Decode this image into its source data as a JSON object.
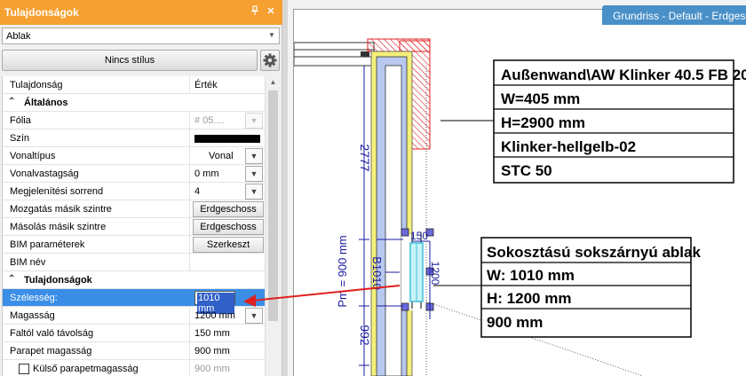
{
  "panel": {
    "title": "Tulajdonságok",
    "pin_icon": "pin-icon",
    "close_icon": "close-icon",
    "type_selector": {
      "value": "Ablak"
    },
    "style_button": {
      "label": "Nincs stílus"
    },
    "settings_icon": "gear-icon",
    "columns": {
      "property": "Tulajdonság",
      "value": "Érték"
    },
    "sections": {
      "general": "Általános",
      "properties": "Tulajdonságok"
    },
    "rows": {
      "foil": {
        "name": "Fólia",
        "value": "# 05...."
      },
      "color": {
        "name": "Szín",
        "swatch": "#000000"
      },
      "linetype": {
        "name": "Vonaltípus",
        "value": "Vonal"
      },
      "lineweight": {
        "name": "Vonalvastagság",
        "value": "0 mm"
      },
      "display_order": {
        "name": "Megjelenítési sorrend",
        "value": "4"
      },
      "move_floor": {
        "name": "Mozgatás másik szintre",
        "value": "Erdgeschoss"
      },
      "copy_floor": {
        "name": "Másolás másik szintre",
        "value": "Erdgeschoss"
      },
      "bim_params": {
        "name": "BIM paraméterek",
        "value": "Szerkeszt"
      },
      "bim_name": {
        "name": "BIM név",
        "value": ""
      },
      "width": {
        "name": "Szélesség:",
        "value": "1010 mm"
      },
      "height": {
        "name": "Magasság",
        "value": "1200 mm"
      },
      "wall_distance": {
        "name": "Faltól való távolság",
        "value": "150 mm"
      },
      "parapet_height": {
        "name": "Parapet magasság",
        "value": "900 mm"
      },
      "outer_parapet": {
        "name": "Külső parapetmagasság",
        "value": "900 mm"
      }
    }
  },
  "document_tab": {
    "label": "Grundriss - Default - Erdgeschoss"
  },
  "drawing": {
    "wall_label": {
      "lines": [
        "Außenwand\\AW Klinker 40.5 FB 20",
        "W=405 mm",
        "H=2900 mm",
        "Klinker-hellgelb-02",
        "STC 50"
      ]
    },
    "window_label": {
      "lines": [
        "Sokosztású sokszárnyú ablak",
        "W: 1010 mm",
        "H: 1200 mm",
        "900 mm"
      ]
    },
    "dimensions": {
      "top": "2777",
      "bottom": "992",
      "window_tag": "B1010",
      "parapet": "Pm = 900 mm",
      "depth_150": "150",
      "height_1200": "1200"
    },
    "colors": {
      "accent": "#f5a030",
      "selection": "#3a8ee6",
      "dimension": "#1a1aa0",
      "wall_fill": "#b8c8f0",
      "insulation": "#f5f07a",
      "hatch": "#e02020",
      "glass": "#40c0d8"
    }
  }
}
